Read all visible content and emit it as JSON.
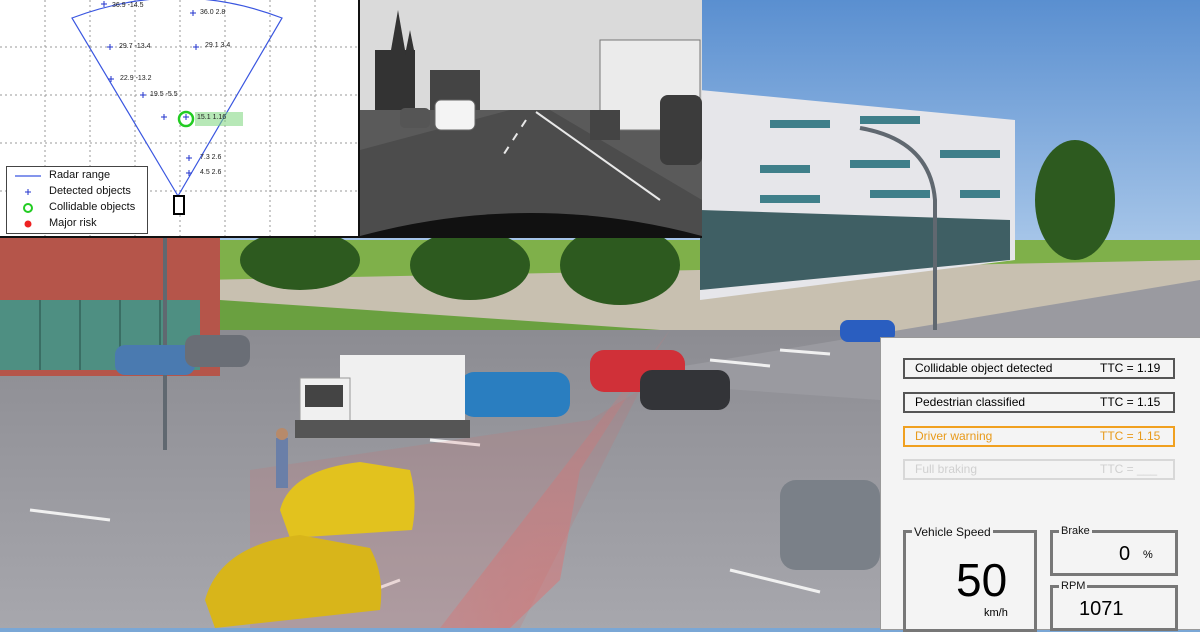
{
  "radar": {
    "targets": [
      {
        "label": "36.9 -14.5"
      },
      {
        "label": "36.0  2.8"
      },
      {
        "label": "29.7 -13.4"
      },
      {
        "label": "29.1  3.4"
      },
      {
        "label": "22.9 -13.2"
      },
      {
        "label": "19.5 -5.5"
      },
      {
        "label": "15.1 1.16"
      },
      {
        "label": "7.3  2.6"
      },
      {
        "label": "4.5  2.6"
      }
    ],
    "legend": {
      "radar_range": "Radar range",
      "detected": "Detected objects",
      "collidable": "Collidable objects",
      "major_risk": "Major risk"
    },
    "colors": {
      "radar_line": "#3a56e0",
      "detected": "#2233cc",
      "collidable": "#22cc22",
      "major_risk": "#ee2222"
    }
  },
  "hud": {
    "rows": [
      {
        "label": "Collidable object detected",
        "ttc_label": "TTC =",
        "ttc_value": "1.19",
        "state": "normal"
      },
      {
        "label": "Pedestrian classified",
        "ttc_label": "TTC =",
        "ttc_value": "1.15",
        "state": "normal"
      },
      {
        "label": "Driver warning",
        "ttc_label": "TTC =",
        "ttc_value": "1.15",
        "state": "warning"
      },
      {
        "label": "Full braking",
        "ttc_label": "TTC =",
        "ttc_value": "___",
        "state": "inactive"
      }
    ],
    "speed": {
      "title": "Vehicle Speed",
      "value": "50",
      "unit": "km/h"
    },
    "brake": {
      "title": "Brake",
      "value": "0",
      "unit": "%"
    },
    "rpm": {
      "title": "RPM",
      "value": "1071"
    },
    "colors": {
      "warning": "#f0a020"
    }
  }
}
